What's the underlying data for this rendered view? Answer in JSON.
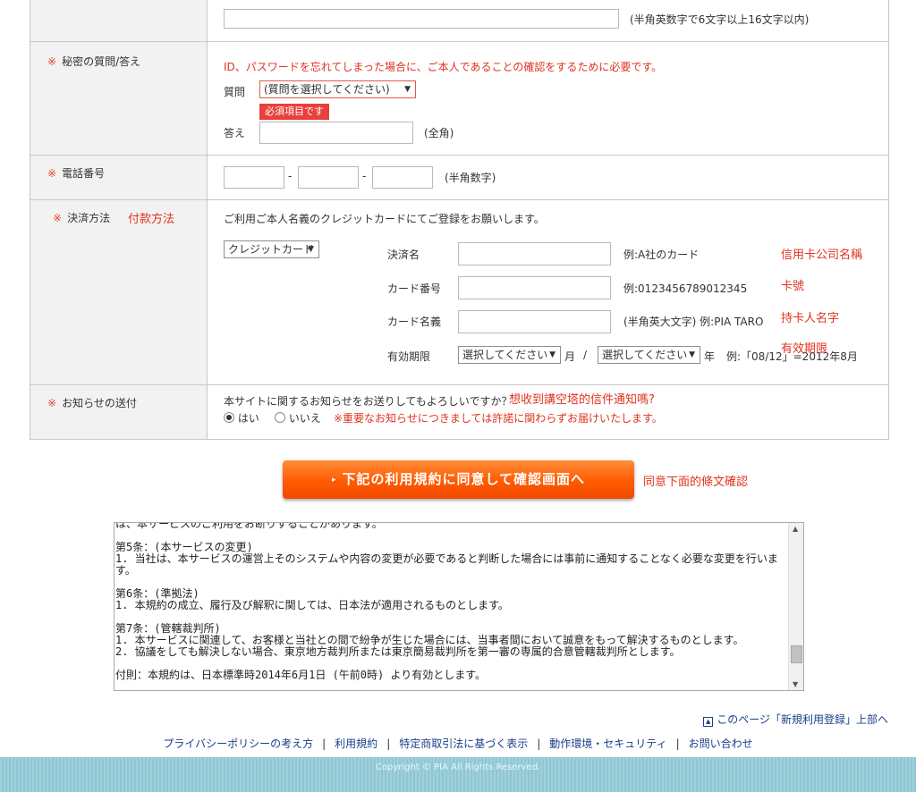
{
  "password_row": {
    "hint": "(半角英数字で6文字以上16文字以内)"
  },
  "secret_row": {
    "label_mark": "※",
    "label": "秘密の質問/答え",
    "notice": "ID、パスワードを忘れてしまった場合に、ご本人であることの確認をするために必要です。",
    "question_label": "質問",
    "question_select": "(質問を選択してください)",
    "required_badge": "必須項目です",
    "answer_label": "答え",
    "answer_hint": "(全角)"
  },
  "phone_row": {
    "label_mark": "※",
    "label": "電話番号",
    "dash": "-",
    "hint": "(半角数字)"
  },
  "payment_row": {
    "label_mark": "※",
    "label": "決済方法",
    "annotation": "付款方法",
    "intro": "ご利用ご本人名義のクレジットカードにてご登録をお願いします。",
    "method_select": "クレジットカード",
    "fields": {
      "name_label": "決済名",
      "name_example": "例:A社のカード",
      "name_annotation": "信用卡公司名稱",
      "number_label": "カード番号",
      "number_example": "例:0123456789012345",
      "number_annotation": "卡號",
      "holder_label": "カード名義",
      "holder_example": "(半角英大文字) 例:PIA TARO",
      "holder_annotation": "持卡人名字",
      "expiry_label": "有効期限",
      "month_select": "選択してください",
      "month_unit": "月",
      "slash": "/",
      "year_select": "選択してください",
      "year_unit": "年",
      "expiry_example": "例:「08/12」=2012年8月",
      "expiry_annotation": "有效期限"
    }
  },
  "notify_row": {
    "label_mark": "※",
    "label": "お知らせの送付",
    "question": "本サイトに関するお知らせをお送りしてもよろしいですか？",
    "annotation": "想收到講空塔的信件通知嗎?",
    "yes": "はい",
    "no": "いいえ",
    "selected": "yes",
    "warning": "※重要なお知らせにつきましては許諾に関わらずお届けいたします。"
  },
  "submit": {
    "label": "下記の利用規約に同意して確認画面へ",
    "annotation": "同意下面的條文確認"
  },
  "terms": {
    "partial_top": "は、本サービスのご利用をお断りすることがあります。",
    "art5_title": "第5条：(本サービスの変更)",
    "art5_body": "1. 当社は、本サービスの運営上そのシステムや内容の変更が必要であると判断した場合には事前に通知することなく必要な変更を行います。",
    "art6_title": "第6条：(準拠法)",
    "art6_body": "1. 本規約の成立、履行及び解釈に関しては、日本法が適用されるものとします。",
    "art7_title": "第7条：(管轄裁判所)",
    "art7_body1": "1. 本サービスに関連して、お客様と当社との間で紛争が生じた場合には、当事者間において誠意をもって解決するものとします。",
    "art7_body2": "2. 協議をしても解決しない場合、東京地方裁判所または東京簡易裁判所を第一審の専属的合意管轄裁判所とします。",
    "supplement": "付則：本規約は、日本標準時2014年6月1日 (午前0時) より有効とします。"
  },
  "page_top_link": "このページ「新規利用登録」上部へ",
  "footer_nav": [
    "プライバシーポリシーの考え方",
    "利用規約",
    "特定商取引法に基づく表示",
    "動作環境・セキュリティ",
    "お問い合わせ"
  ],
  "footer_separator": "|",
  "copyright": "Copyright © PIA All Rights Reserved.",
  "colors": {
    "accent_red": "#e0321e",
    "button_orange": "#ff5a00",
    "link_blue": "#1a3f8a",
    "footer_teal": "#9ed1dc"
  }
}
